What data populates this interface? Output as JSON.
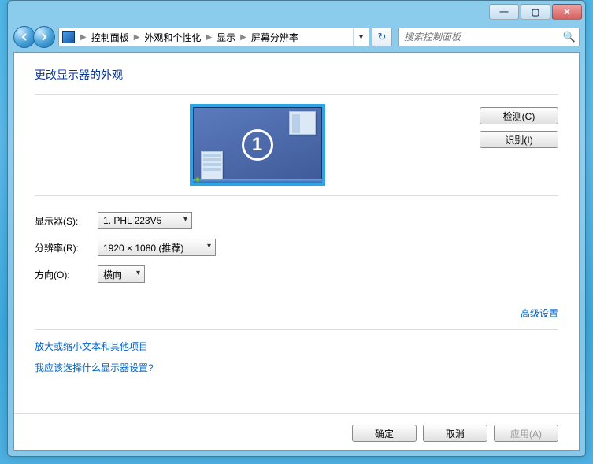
{
  "titlebar": {
    "min": "—",
    "max": "▢",
    "close": "✕"
  },
  "breadcrumb": {
    "items": [
      "控制面板",
      "外观和个性化",
      "显示",
      "屏幕分辨率"
    ]
  },
  "search": {
    "placeholder": "搜索控制面板"
  },
  "heading": "更改显示器的外观",
  "monitor_number": "1",
  "buttons": {
    "detect": "检测(C)",
    "identify": "识别(I)",
    "ok": "确定",
    "cancel": "取消",
    "apply": "应用(A)"
  },
  "labels": {
    "display": "显示器(S):",
    "resolution": "分辨率(R):",
    "orientation": "方向(O):"
  },
  "values": {
    "display": "1. PHL 223V5",
    "resolution": "1920 × 1080 (推荐)",
    "orientation": "横向"
  },
  "links": {
    "advanced": "高级设置",
    "text_size": "放大或缩小文本和其他项目",
    "which_monitor": "我应该选择什么显示器设置?"
  }
}
